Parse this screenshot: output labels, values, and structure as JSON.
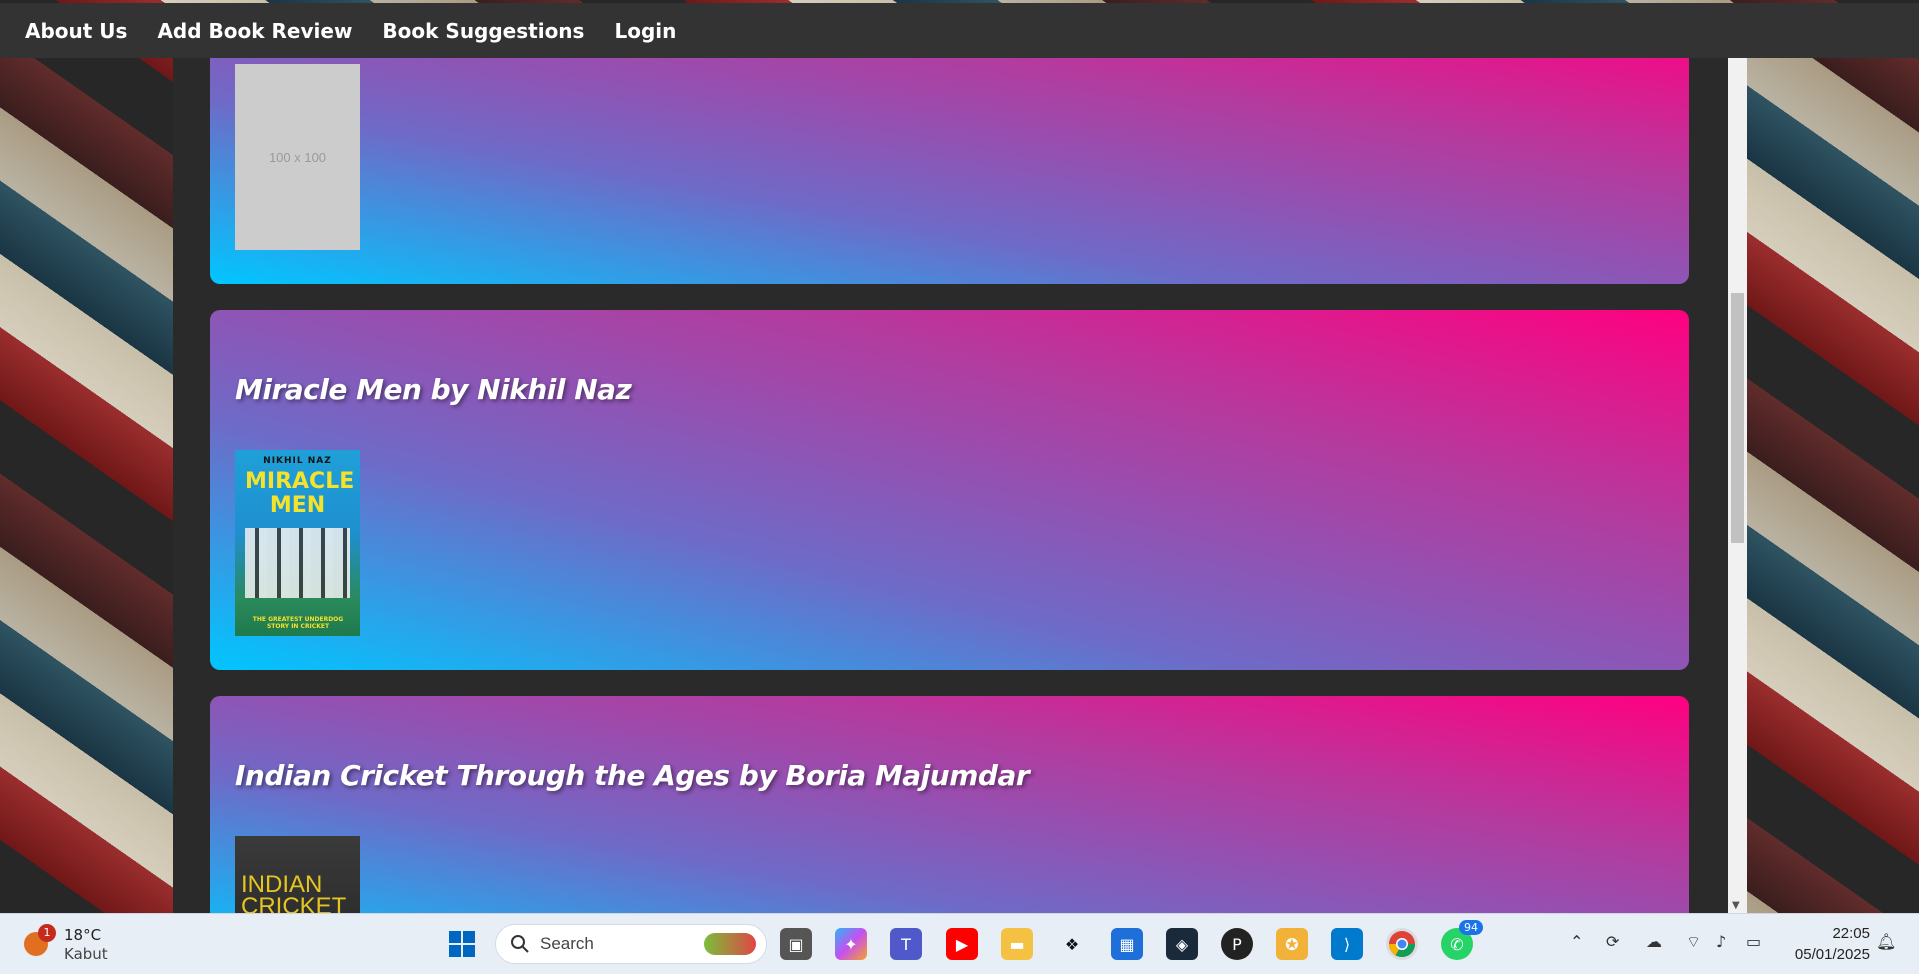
{
  "nav": {
    "items": [
      "About Us",
      "Add Book Review",
      "Book Suggestions",
      "Login"
    ]
  },
  "cards": [
    {
      "title": "",
      "cover_text": "100 x 100"
    },
    {
      "title": "Miracle Men by Nikhil Naz",
      "cover_author": "NIKHIL NAZ",
      "cover_title": "MIRACLE MEN",
      "cover_tagline": "THE GREATEST UNDERDOG STORY IN CRICKET"
    },
    {
      "title": "Indian Cricket Through the Ages by Boria Majumdar",
      "cover_title": "INDIAN CRICKET"
    }
  ],
  "taskbar": {
    "weather_temp": "18°C",
    "weather_cond": "Kabut",
    "weather_badge": "1",
    "search_placeholder": "Search",
    "whatsapp_badge": "94",
    "time": "22:05",
    "date": "05/01/2025"
  },
  "colors": {
    "navbar_bg": "#333333",
    "card_gradient_start": "#00c6ff",
    "card_gradient_end": "#ff0080"
  }
}
